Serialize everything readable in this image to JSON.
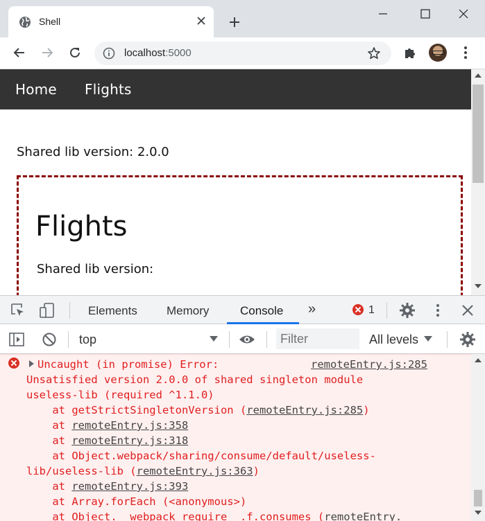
{
  "browser": {
    "tab_title": "Shell",
    "url_host": "localhost",
    "url_port": ":5000"
  },
  "app": {
    "nav": [
      "Home",
      "Flights"
    ],
    "shell_version_label": "Shared lib version: 2.0.0",
    "remote": {
      "title": "Flights",
      "version_label": "Shared lib version:"
    }
  },
  "devtools": {
    "tabs": [
      "Elements",
      "Memory",
      "Console"
    ],
    "active_tab": "Console",
    "more_tabs": "»",
    "error_count": "1",
    "context": "top",
    "filter_placeholder": "Filter",
    "levels": "All levels",
    "message": {
      "source": "remoteEntry.js:285",
      "line1": "Uncaught (in promise) Error:",
      "line2": "Unsatisfied version 2.0.0 of shared singleton module",
      "line3": "useless-lib (required ^1.1.0)",
      "frames": [
        {
          "pre": "    at getStrictSingletonVersion (",
          "link": "remoteEntry.js:285",
          "post": ")"
        },
        {
          "pre": "    at ",
          "link": "remoteEntry.js:358",
          "post": ""
        },
        {
          "pre": "    at ",
          "link": "remoteEntry.js:318",
          "post": ""
        },
        {
          "pre": "    at Object.webpack/sharing/consume/default/useless-",
          "link": "",
          "post": ""
        },
        {
          "pre": "lib/useless-lib (",
          "link": "remoteEntry.js:363",
          "post": ")"
        },
        {
          "pre": "    at ",
          "link": "remoteEntry.js:393",
          "post": ""
        },
        {
          "pre": "    at Array.forEach (<anonymous>)",
          "link": "",
          "post": ""
        },
        {
          "pre": "    at Object.__webpack_require__.f.consumes (",
          "link": "remoteEntry.",
          "post": ""
        }
      ]
    }
  },
  "colors": {
    "app_nav_bg": "#333333",
    "remote_border": "#8b0000",
    "error_red": "#e01e1e",
    "active_tab_underline": "#1a73e8"
  }
}
